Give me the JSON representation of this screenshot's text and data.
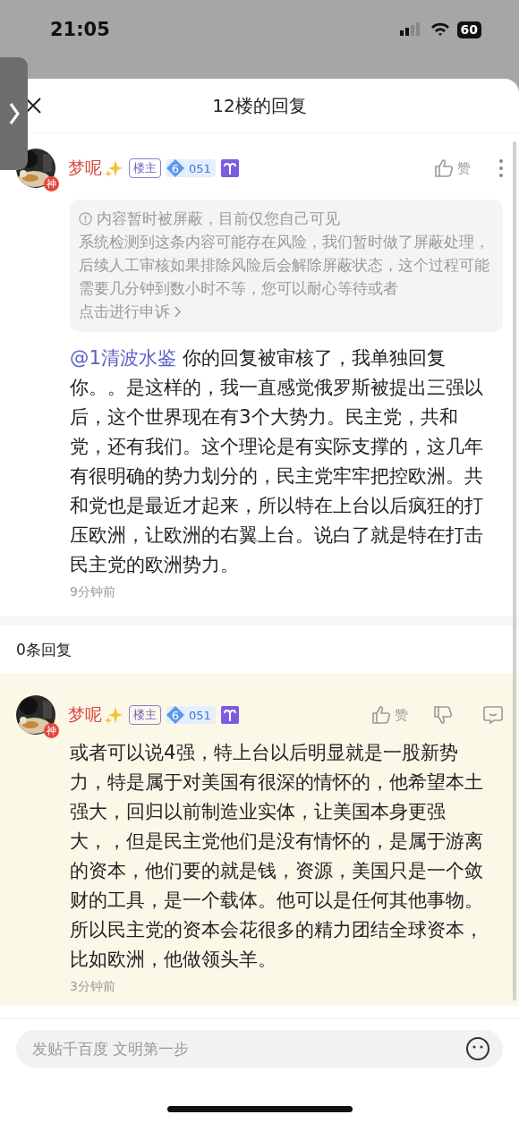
{
  "status_bar": {
    "time": "21:05",
    "battery": "60"
  },
  "sheet": {
    "title": "12楼的回复"
  },
  "main_comment": {
    "user": "梦呢",
    "avatar_badge": "神",
    "owner_badge": "楼主",
    "level": "6",
    "level_points": "051",
    "like_label": "赞",
    "notice": {
      "title": "内容暂时被屏蔽，目前仅您自己可见",
      "text": "系统检测到这条内容可能存在风险，我们暂时做了屏蔽处理，后续人工审核如果排除风险后会解除屏蔽状态，这个过程可能需要几分钟到数小时不等，您可以耐心等待或者",
      "link": "点击进行申诉"
    },
    "mention": "@1清波水鉴",
    "text": "你的回复被审核了，我单独回复你。。是这样的，我一直感觉俄罗斯被提出三强以后，这个世界现在有3个大势力。民主党，共和党，还有我们。这个理论是有实际支撑的，这几年有很明确的势力划分的，民主党牢牢把控欧洲。共和党也是最近才起来，所以特在上台以后疯狂的打压欧洲，让欧洲的右翼上台。说白了就是特在打击民主党的欧洲势力。",
    "time": "9分钟前"
  },
  "reply_count": "0条回复",
  "replies": [
    {
      "user": "梦呢",
      "avatar_badge": "神",
      "owner_badge": "楼主",
      "level": "6",
      "level_points": "051",
      "like_label": "赞",
      "highlighted": true,
      "text": "或者可以说4强，特上台以后明显就是一股新势力，特是属于对美国有很深的情怀的，他希望本土强大，回归以前制造业实体，让美国本身更强大，，但是民主党他们是没有情怀的，是属于游离的资本，他们要的就是钱，资源，美国只是一个敛财的工具，是一个载体。他可以是任何其他事物。所以民主党的资本会花很多的精力团结全球资本，比如欧洲，他做领头羊。",
      "time": "3分钟前"
    }
  ],
  "composer": {
    "placeholder": "发贴千百度 文明第一步"
  }
}
